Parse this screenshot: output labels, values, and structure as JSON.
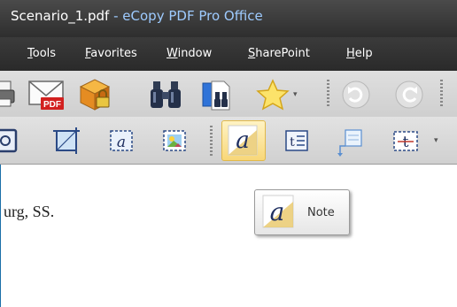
{
  "window": {
    "file_name": "Scenario_1.pdf",
    "separator": " - ",
    "app_name": "eCopy PDF Pro Office"
  },
  "menu": {
    "items": [
      "Tools",
      "Favorites",
      "Window",
      "SharePoint",
      "Help"
    ]
  },
  "toolbar1": {
    "buttons": [
      "print-icon",
      "email-pdf-icon",
      "secure-package-icon",
      "binoculars-find-icon",
      "find-in-document-icon",
      "star-favorite-icon",
      "undo-icon",
      "redo-icon"
    ],
    "pdf_badge": "PDF"
  },
  "toolbar2": {
    "buttons": [
      "rotate-page-icon",
      "crop-icon",
      "text-box-icon",
      "image-icon",
      "note-icon",
      "text-field-icon",
      "callout-icon",
      "typewriter-icon"
    ],
    "glyph_a": "a",
    "glyph_t": "t"
  },
  "document": {
    "visible_text": "urg, SS."
  },
  "tooltip": {
    "label": "Note"
  },
  "colors": {
    "title_bar": "#3a3a3a",
    "title_accent": "#9ecbff",
    "toolbar": "#d6d6d6",
    "note_gold": "#e8c766"
  }
}
